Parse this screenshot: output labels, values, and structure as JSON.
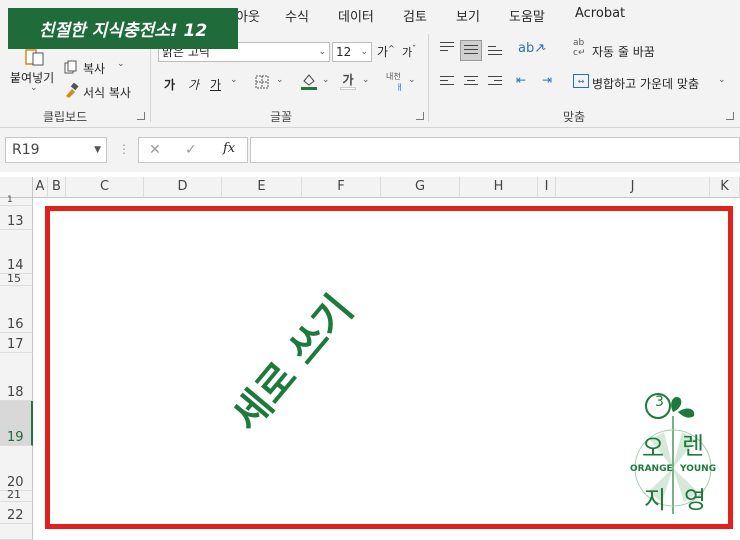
{
  "banner": {
    "text": "친절한 지식충전소! 12"
  },
  "tabs": [
    "아웃",
    "수식",
    "데이터",
    "검토",
    "보기",
    "도움말",
    "Acrobat"
  ],
  "clipboard": {
    "paste_label": "붙여넣기",
    "copy_label": "복사",
    "format_painter_label": "서식 복사",
    "group_label": "클립보드"
  },
  "font": {
    "name_value": "맑은 고딕",
    "size_value": "12",
    "group_label": "글꼴",
    "bold_glyph": "가",
    "italic_glyph": "가",
    "underline_glyph": "가",
    "grow_glyph": "가",
    "shrink_glyph": "가",
    "text_color_glyph": "가",
    "phonetic_glyph": "내천"
  },
  "alignment": {
    "wrap_label": "자동 줄 바꿈",
    "merge_label": "병합하고 가운데 맞춤",
    "group_label": "맞춤"
  },
  "formula_bar": {
    "name_box": "R19",
    "fx": "fx",
    "cancel": "✕",
    "enter": "✓",
    "formula": ""
  },
  "columns": [
    "A",
    "B",
    "C",
    "D",
    "E",
    "F",
    "G",
    "H",
    "I",
    "J",
    "K"
  ],
  "rows": [
    "1",
    "13",
    "14",
    "15",
    "16",
    "17",
    "18",
    "19",
    "20",
    "21",
    "22"
  ],
  "selected_row": "19",
  "sheet": {
    "rotated_text": "세로 쓰기"
  },
  "logo": {
    "text_top_left": "오",
    "text_top_right": "렌",
    "text_bottom_left": "지",
    "text_bottom_right": "영",
    "left_word": "ORANGE",
    "right_word": "YOUNG",
    "number": "3"
  },
  "colors": {
    "excel_green": "#217346",
    "frame_red": "#e3211c",
    "text_green": "#1d7a3c"
  }
}
